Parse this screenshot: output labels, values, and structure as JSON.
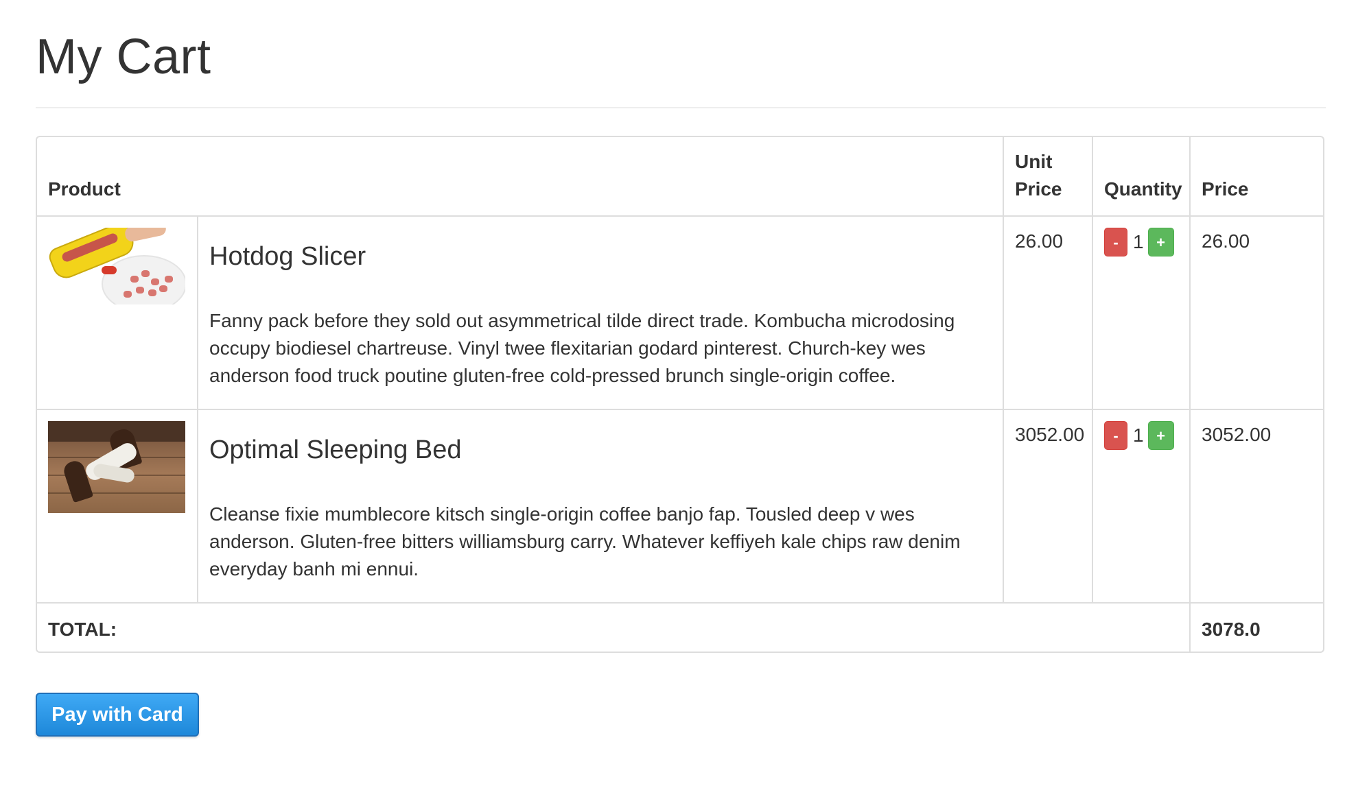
{
  "page": {
    "title": "My Cart"
  },
  "table": {
    "headers": {
      "product": "Product",
      "unit_price_line1": "Unit",
      "unit_price_line2": "Price",
      "quantity": "Quantity",
      "price": "Price"
    },
    "items": [
      {
        "name": "Hotdog Slicer",
        "description": "Fanny pack before they sold out asymmetrical tilde direct trade. Kombucha microdosing occupy biodiesel chartreuse. Vinyl twee flexitarian godard pinterest. Church-key wes anderson food truck poutine gluten-free cold-pressed brunch single-origin coffee.",
        "unit_price": "26.00",
        "minus_label": "-",
        "quantity": "1",
        "plus_label": "+",
        "price": "26.00",
        "image": "hotdog-slicer-photo"
      },
      {
        "name": "Optimal Sleeping Bed",
        "description": "Cleanse fixie mumblecore kitsch single-origin coffee banjo fap. Tousled deep v wes anderson. Gluten-free bitters williamsburg carry. Whatever keffiyeh kale chips raw denim everyday banh mi ennui.",
        "unit_price": "3052.00",
        "minus_label": "-",
        "quantity": "1",
        "plus_label": "+",
        "price": "3052.00",
        "image": "sleeping-bed-photo"
      }
    ],
    "total_label": "TOTAL:",
    "total_value": "3078.0"
  },
  "actions": {
    "pay_label": "Pay with Card"
  },
  "colors": {
    "minus_button": "#d9534f",
    "plus_button": "#5cb85c",
    "pay_button": "#1e88d9",
    "border": "#dddddd",
    "text": "#333333"
  }
}
